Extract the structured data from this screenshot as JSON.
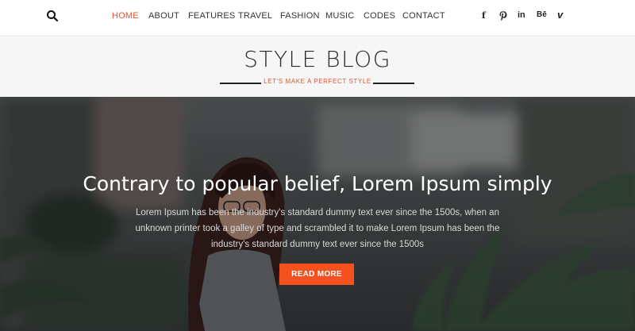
{
  "nav": {
    "items": [
      {
        "label": "HOME",
        "active": true
      },
      {
        "label": "ABOUT",
        "active": false
      },
      {
        "label": "FEATURES",
        "active": false
      },
      {
        "label": "TRAVEL",
        "active": false
      },
      {
        "label": "FASHION",
        "active": false
      },
      {
        "label": "MUSIC",
        "active": false
      },
      {
        "label": "CODES",
        "active": false
      },
      {
        "label": "CONTACT",
        "active": false
      }
    ],
    "search_icon": "search-icon",
    "social": [
      "facebook-icon",
      "pinterest-icon",
      "linkedin-icon",
      "behance-icon",
      "vimeo-icon"
    ],
    "social_labels": {
      "facebook": "f",
      "linkedin": "in",
      "behance": "Bē",
      "vimeo": "v"
    }
  },
  "header": {
    "title": "STYLE BLOG",
    "tagline": "LET'S MAKE A PERFECT STYLE"
  },
  "hero": {
    "title": "Contrary to popular belief, Lorem Ipsum simply",
    "text": "Lorem Ipsum has been the industry's standard dummy text ever since the 1500s, when an unknown printer took a galley of type and scrambled it to make Lorem Ipsum has been the industry's standard dummy text ever since the 1500s",
    "button_label": "READ MORE"
  },
  "colors": {
    "accent": "#f4511e",
    "active_nav": "#e8532f",
    "header_bg": "#f6f6f6"
  }
}
